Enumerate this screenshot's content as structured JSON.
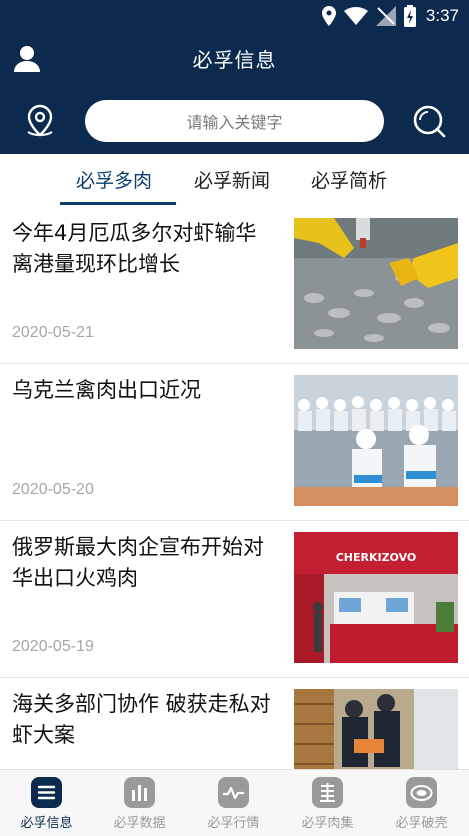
{
  "status_bar": {
    "time": "3:37"
  },
  "header": {
    "title": "必孚信息",
    "search_placeholder": "请输入关键字"
  },
  "tabs": [
    {
      "label": "必孚多肉",
      "active": true
    },
    {
      "label": "必孚新闻",
      "active": false
    },
    {
      "label": "必孚简析",
      "active": false
    }
  ],
  "news": [
    {
      "title": "今年4月厄瓜多尔对虾输华离港量现环比增长",
      "date": "2020-05-21"
    },
    {
      "title": "乌克兰禽肉出口近况",
      "date": "2020-05-20"
    },
    {
      "title": "俄罗斯最大肉企宣布开始对华出口火鸡肉",
      "date": "2020-05-19",
      "image_text": "CHERKIZOVO"
    },
    {
      "title": "海关多部门协作 破获走私对虾大案",
      "date": ""
    }
  ],
  "bottom_nav": [
    {
      "label": "必孚信息",
      "active": true,
      "icon": "list-icon"
    },
    {
      "label": "必孚数据",
      "active": false,
      "icon": "bar-chart-icon"
    },
    {
      "label": "必孚行情",
      "active": false,
      "icon": "trend-icon"
    },
    {
      "label": "必孚肉集",
      "active": false,
      "icon": "market-icon"
    },
    {
      "label": "必孚破壳",
      "active": false,
      "icon": "egg-icon"
    }
  ],
  "colors": {
    "primary": "#0b2a4e",
    "accent": "#0b3d6e"
  }
}
